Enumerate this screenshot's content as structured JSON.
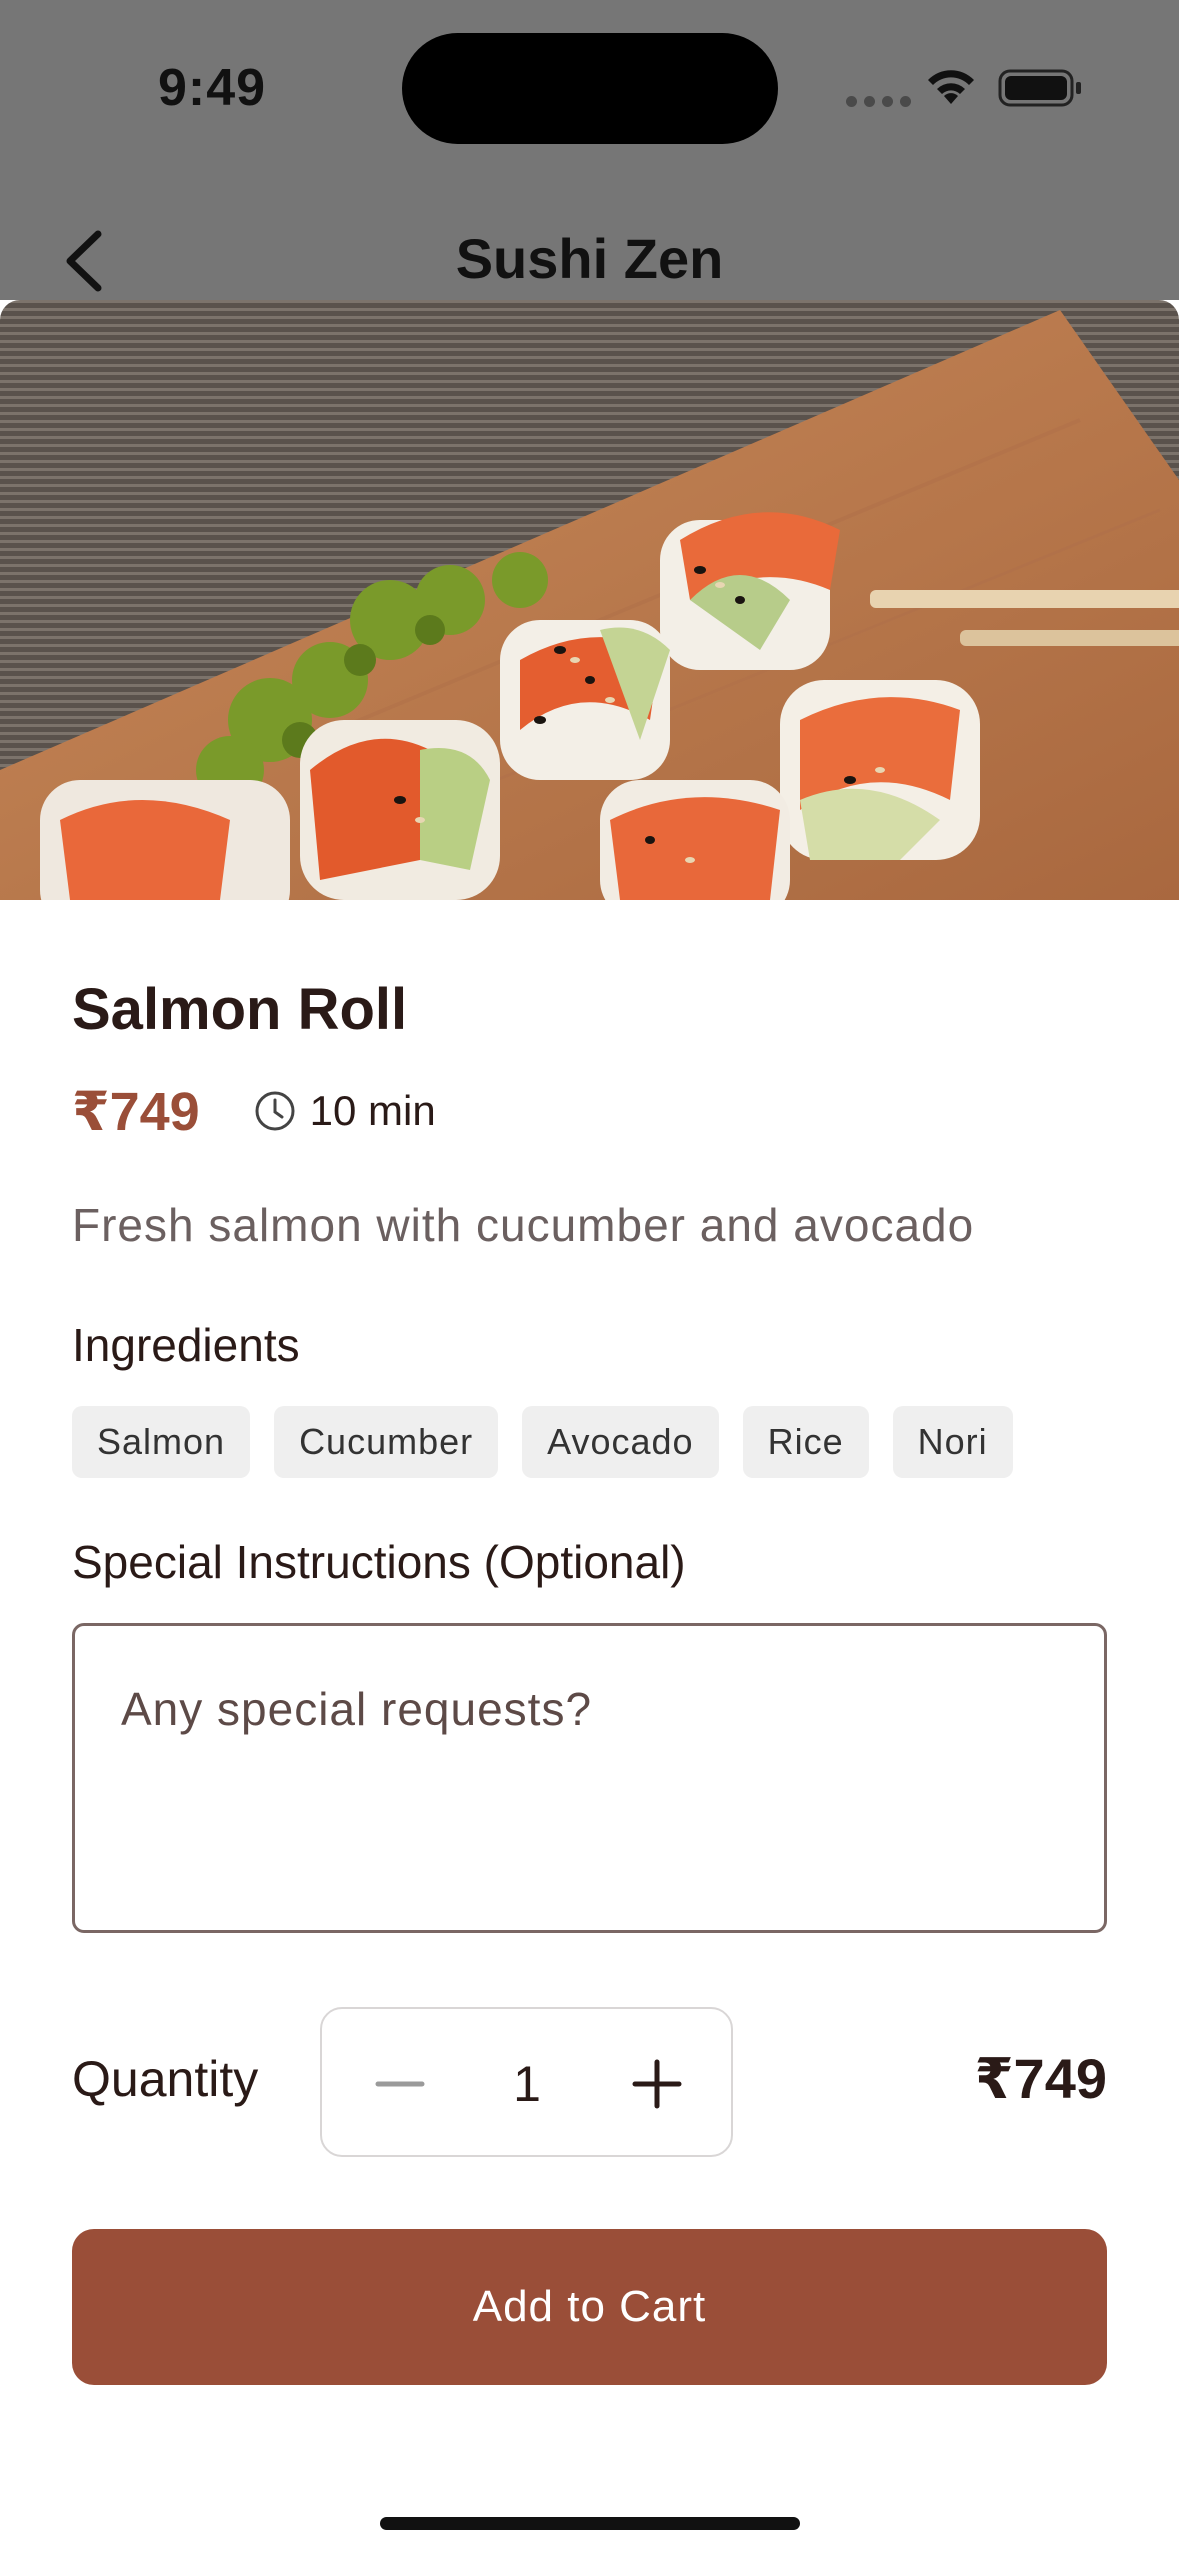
{
  "status_bar": {
    "time": "9:49"
  },
  "nav": {
    "title": "Sushi Zen",
    "back_icon": "chevron-left-icon"
  },
  "hero": {
    "alt": "Salmon roll sushi on a wooden board"
  },
  "dish": {
    "name": "Salmon Roll",
    "price": "₹749",
    "prep_time": "10 min",
    "description": "Fresh salmon with cucumber and avocado"
  },
  "ingredients": {
    "title": "Ingredients",
    "items": [
      "Salmon",
      "Cucumber",
      "Avocado",
      "Rice",
      "Nori"
    ]
  },
  "special_instructions": {
    "title": "Special Instructions (Optional)",
    "placeholder": "Any special requests?",
    "value": ""
  },
  "quantity": {
    "label": "Quantity",
    "value": "1",
    "total": "₹749"
  },
  "cta": {
    "label": "Add to Cart"
  },
  "colors": {
    "accent": "#9a4e38",
    "header_overlay": "#767676",
    "chip_bg": "#efefef"
  }
}
